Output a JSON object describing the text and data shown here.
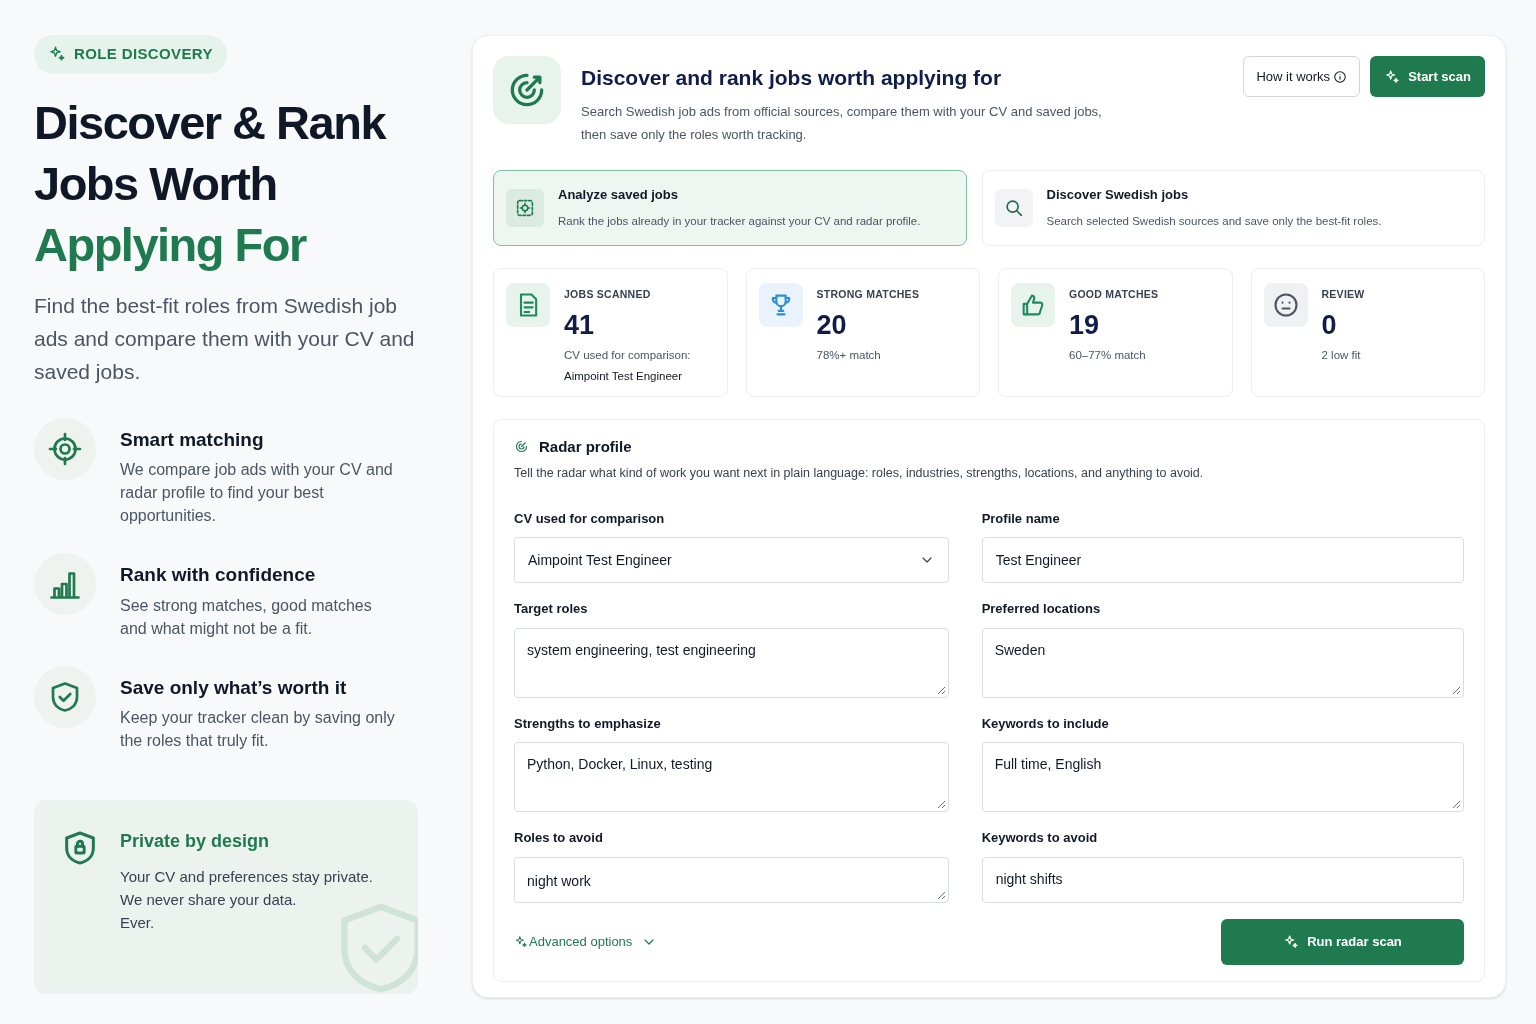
{
  "hero": {
    "badge": "ROLE DISCOVERY",
    "title_lines": [
      "Discover & Rank",
      "Jobs Worth"
    ],
    "title_accent": "Applying For",
    "subtitle": "Find the best-fit roles from Swedish job ads and compare them with your CV and saved jobs."
  },
  "features": [
    {
      "title": "Smart matching",
      "text": "We compare job ads with your CV and radar profile to find your best opportunities."
    },
    {
      "title": "Rank with confidence",
      "text": "See strong matches, good matches and what might not be a fit."
    },
    {
      "title": "Save only what’s worth it",
      "text": "Keep your tracker clean by saving only the roles that truly fit."
    }
  ],
  "privacy": {
    "title": "Private by design",
    "lines": [
      "Your CV and preferences stay private.",
      "We never share your data.",
      "Ever."
    ]
  },
  "header": {
    "title": "Discover and rank jobs worth applying for",
    "description_lines": [
      "Search Swedish job ads from official sources, compare them with your CV and saved jobs,",
      "then save only the roles worth tracking."
    ],
    "help_button": "How it works",
    "primary_button": "Start scan"
  },
  "modes": [
    {
      "title": "Analyze saved jobs",
      "text": "Rank the jobs already in your tracker against your CV and radar profile.",
      "selected": true
    },
    {
      "title": "Discover Swedish jobs",
      "text": "Search selected Swedish sources and save only the best-fit roles.",
      "selected": false
    }
  ],
  "stats": [
    {
      "label": "JOBS SCANNED",
      "value": "41",
      "notes": [
        "CV used for comparison:",
        "Aimpoint Test Engineer"
      ],
      "color": "#1f8a5b"
    },
    {
      "label": "STRONG MATCHES",
      "value": "20",
      "notes": [
        "78%+ match"
      ],
      "color": "#2b8fd6"
    },
    {
      "label": "GOOD MATCHES",
      "value": "19",
      "notes": [
        "60–77% match"
      ],
      "color": "#1f8a5b"
    },
    {
      "label": "REVIEW",
      "value": "0",
      "notes": [
        "2 low fit"
      ],
      "color": "#4b5563"
    }
  ],
  "radar_profile": {
    "title": "Radar profile",
    "description": "Tell the radar what kind of work you want next in plain language: roles, industries, strengths, locations, and anything to avoid.",
    "fields": [
      {
        "label": "CV used for comparison",
        "value": "Aimpoint Test Engineer",
        "kind": "select"
      },
      {
        "label": "Profile name",
        "value": "Test Engineer",
        "kind": "input"
      },
      {
        "label": "Target roles",
        "value": "system engineering, test engineering",
        "kind": "textarea"
      },
      {
        "label": "Preferred locations",
        "value": "Sweden",
        "kind": "textarea"
      },
      {
        "label": "Strengths to emphasize",
        "value": "Python, Docker, Linux, testing",
        "kind": "textarea"
      },
      {
        "label": "Keywords to include",
        "value": "Full time, English",
        "kind": "textarea"
      },
      {
        "label": "Roles to avoid",
        "value": "night work",
        "kind": "textarea-short"
      },
      {
        "label": "Keywords to avoid",
        "value": "night shifts",
        "kind": "input"
      }
    ],
    "advanced_link": "Advanced options",
    "run_button": "Run radar scan"
  }
}
